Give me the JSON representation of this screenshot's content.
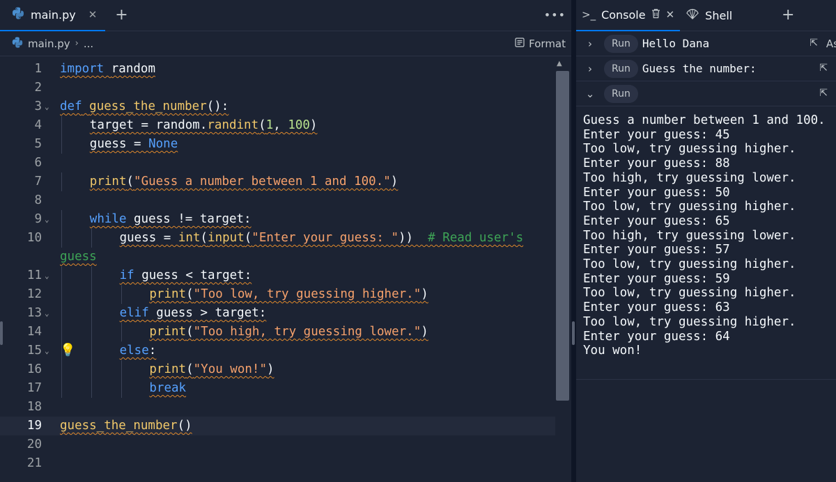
{
  "editor": {
    "tab": {
      "label": "main.py",
      "icon": "python-icon"
    },
    "breadcrumb": {
      "file": "main.py",
      "more": "..."
    },
    "format_label": "Format",
    "active_line": 19,
    "lines": [
      {
        "n": "1",
        "fold": false,
        "indent": 0,
        "tokens": [
          {
            "t": "import",
            "c": "kw"
          },
          {
            "t": " ",
            "c": "plain"
          },
          {
            "t": "random",
            "c": "plain"
          }
        ]
      },
      {
        "n": "2",
        "fold": false,
        "indent": 0,
        "tokens": []
      },
      {
        "n": "3",
        "fold": true,
        "indent": 0,
        "tokens": [
          {
            "t": "def",
            "c": "kw"
          },
          {
            "t": " ",
            "c": "plain"
          },
          {
            "t": "guess_the_number",
            "c": "fn"
          },
          {
            "t": "():",
            "c": "plain"
          }
        ]
      },
      {
        "n": "4",
        "fold": false,
        "indent": 1,
        "tokens": [
          {
            "t": "target = random.",
            "c": "plain"
          },
          {
            "t": "randint",
            "c": "fn"
          },
          {
            "t": "(",
            "c": "plain"
          },
          {
            "t": "1",
            "c": "num"
          },
          {
            "t": ", ",
            "c": "plain"
          },
          {
            "t": "100",
            "c": "num"
          },
          {
            "t": ")",
            "c": "plain"
          }
        ]
      },
      {
        "n": "5",
        "fold": false,
        "indent": 1,
        "tokens": [
          {
            "t": "guess = ",
            "c": "plain"
          },
          {
            "t": "None",
            "c": "kw"
          }
        ]
      },
      {
        "n": "6",
        "fold": false,
        "indent": 0,
        "tokens": []
      },
      {
        "n": "7",
        "fold": false,
        "indent": 1,
        "tokens": [
          {
            "t": "print",
            "c": "fn"
          },
          {
            "t": "(",
            "c": "plain"
          },
          {
            "t": "\"Guess a number between 1 and 100.\"",
            "c": "str"
          },
          {
            "t": ")",
            "c": "plain"
          }
        ]
      },
      {
        "n": "8",
        "fold": false,
        "indent": 0,
        "tokens": []
      },
      {
        "n": "9",
        "fold": true,
        "indent": 1,
        "tokens": [
          {
            "t": "while",
            "c": "kw"
          },
          {
            "t": " guess != target:",
            "c": "plain"
          }
        ]
      },
      {
        "n": "10",
        "fold": false,
        "indent": 2,
        "tokens": [
          {
            "t": "guess = ",
            "c": "plain"
          },
          {
            "t": "int",
            "c": "fn"
          },
          {
            "t": "(",
            "c": "plain"
          },
          {
            "t": "input",
            "c": "fn"
          },
          {
            "t": "(",
            "c": "plain"
          },
          {
            "t": "\"Enter your guess: \"",
            "c": "str"
          },
          {
            "t": "))  ",
            "c": "plain"
          },
          {
            "t": "# Read user's",
            "c": "cmt"
          }
        ]
      },
      {
        "n": "",
        "fold": false,
        "indent": 0,
        "tokens": [
          {
            "t": "guess",
            "c": "cmt"
          }
        ]
      },
      {
        "n": "11",
        "fold": true,
        "indent": 2,
        "tokens": [
          {
            "t": "if",
            "c": "kw"
          },
          {
            "t": " guess < target:",
            "c": "plain"
          }
        ]
      },
      {
        "n": "12",
        "fold": false,
        "indent": 3,
        "tokens": [
          {
            "t": "print",
            "c": "fn"
          },
          {
            "t": "(",
            "c": "plain"
          },
          {
            "t": "\"Too low, try guessing higher.\"",
            "c": "str"
          },
          {
            "t": ")",
            "c": "plain"
          }
        ]
      },
      {
        "n": "13",
        "fold": true,
        "indent": 2,
        "tokens": [
          {
            "t": "elif",
            "c": "kw"
          },
          {
            "t": " guess > target:",
            "c": "plain"
          }
        ]
      },
      {
        "n": "14",
        "fold": false,
        "indent": 3,
        "tokens": [
          {
            "t": "print",
            "c": "fn"
          },
          {
            "t": "(",
            "c": "plain"
          },
          {
            "t": "\"Too high, try guessing lower.\"",
            "c": "str"
          },
          {
            "t": ")",
            "c": "plain"
          }
        ]
      },
      {
        "n": "15",
        "fold": true,
        "indent": 2,
        "tokens": [
          {
            "t": "else",
            "c": "kw"
          },
          {
            "t": ":",
            "c": "plain"
          }
        ]
      },
      {
        "n": "16",
        "fold": false,
        "indent": 3,
        "tokens": [
          {
            "t": "print",
            "c": "fn"
          },
          {
            "t": "(",
            "c": "plain"
          },
          {
            "t": "\"You won!\"",
            "c": "str"
          },
          {
            "t": ")",
            "c": "plain"
          }
        ]
      },
      {
        "n": "17",
        "fold": false,
        "indent": 3,
        "tokens": [
          {
            "t": "break",
            "c": "kw"
          }
        ]
      },
      {
        "n": "18",
        "fold": false,
        "indent": 0,
        "tokens": []
      },
      {
        "n": "19",
        "fold": false,
        "indent": 0,
        "tokens": [
          {
            "t": "guess_the_number",
            "c": "fn"
          },
          {
            "t": "()",
            "c": "plain"
          }
        ]
      },
      {
        "n": "20",
        "fold": false,
        "indent": 0,
        "tokens": []
      },
      {
        "n": "21",
        "fold": false,
        "indent": 0,
        "tokens": []
      }
    ]
  },
  "console": {
    "tabs": [
      {
        "label": "Console",
        "icon": "terminal-prompt-icon",
        "active": true
      },
      {
        "label": "Shell",
        "icon": "shell-icon",
        "active": false
      }
    ],
    "runs": [
      {
        "badge": "Run",
        "text": "Hello Dana",
        "expanded": false,
        "trailing": "As"
      },
      {
        "badge": "Run",
        "text": "Guess the number:",
        "expanded": false,
        "trailing": ""
      },
      {
        "badge": "Run",
        "text": "",
        "expanded": true,
        "trailing": ""
      }
    ],
    "output": [
      "Guess a number between 1 and 100.",
      "Enter your guess: 45",
      "Too low, try guessing higher.",
      "Enter your guess: 88",
      "Too high, try guessing lower.",
      "Enter your guess: 50",
      "Too low, try guessing higher.",
      "Enter your guess: 65",
      "Too high, try guessing lower.",
      "Enter your guess: 57",
      "Too low, try guessing higher.",
      "Enter your guess: 59",
      "Too low, try guessing higher.",
      "Enter your guess: 63",
      "Too low, try guessing higher.",
      "Enter your guess: 64",
      "You won!"
    ]
  },
  "colors": {
    "background": "#1c2333",
    "accent": "#0079f2",
    "keyword": "#56a1ff",
    "function": "#f1c86a",
    "string": "#f7a26c",
    "number": "#b9e28e",
    "comment": "#3ea456",
    "squiggle": "#e0892b"
  }
}
